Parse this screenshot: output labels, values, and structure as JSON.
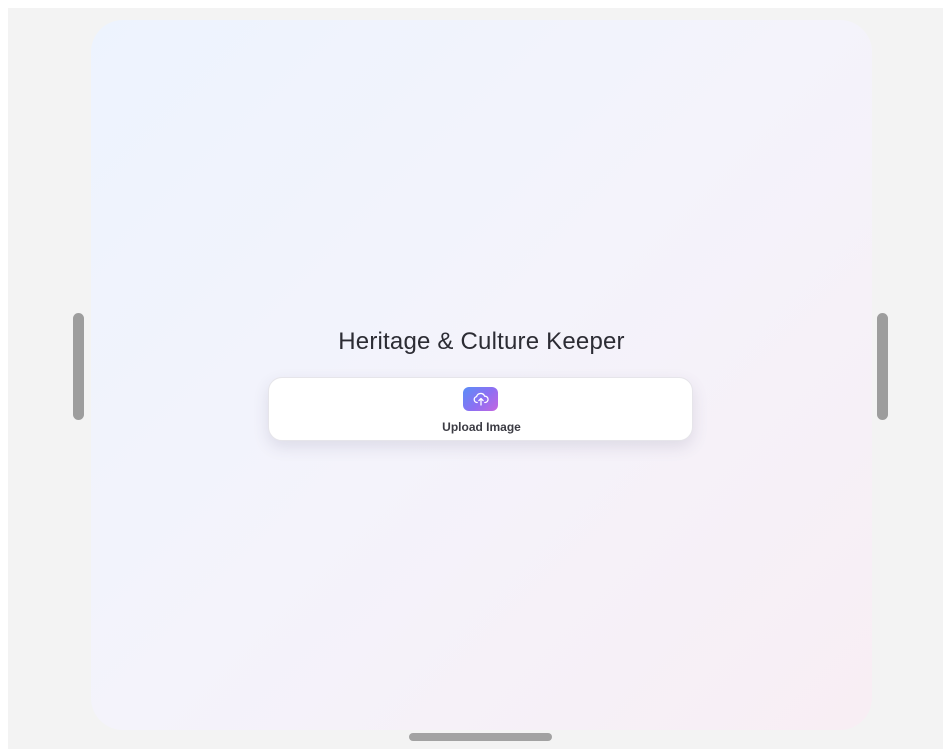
{
  "app": {
    "title": "Heritage & Culture Keeper"
  },
  "upload": {
    "label": "Upload Image",
    "icon": "cloud-upload-icon"
  },
  "colors": {
    "accent_gradient_start": "#5a8ef7",
    "accent_gradient_end": "#c566e0",
    "panel_gradient_start": "#edf3fe",
    "panel_gradient_end": "#f8eef4",
    "handle": "#9d9d9d"
  }
}
